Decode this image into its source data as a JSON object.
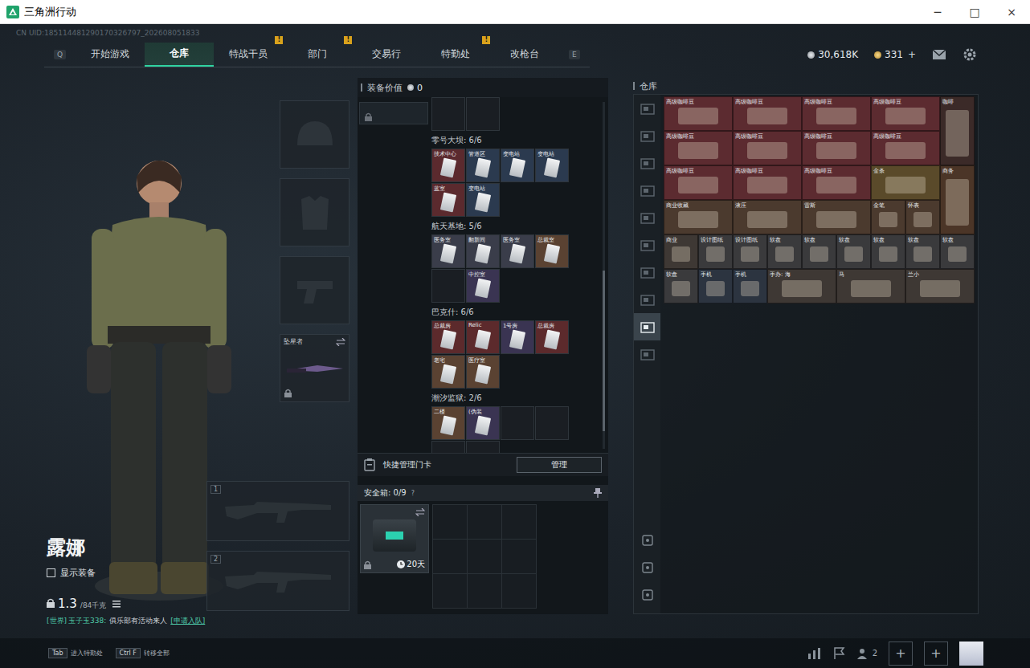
{
  "window": {
    "title": "三角洲行动",
    "controls": [
      "─",
      "□",
      "×"
    ]
  },
  "uid": "CN UID:185114481290170326797_202608051833",
  "nav": {
    "prev_key": "Q",
    "next_key": "E",
    "tabs": [
      {
        "label": "开始游戏",
        "selected": false,
        "badge": null
      },
      {
        "label": "仓库",
        "selected": true,
        "badge": null
      },
      {
        "label": "特战干员",
        "selected": false,
        "badge": "!"
      },
      {
        "label": "部门",
        "selected": false,
        "badge": "!"
      },
      {
        "label": "交易行",
        "selected": false,
        "badge": null
      },
      {
        "label": "特勤处",
        "selected": false,
        "badge": "!"
      },
      {
        "label": "改枪台",
        "selected": false,
        "badge": null
      }
    ]
  },
  "currency": [
    {
      "kind": "silver",
      "amount": "30,618K",
      "add": null
    },
    {
      "kind": "gold",
      "amount": "331",
      "add": "+"
    }
  ],
  "operator": {
    "name": "露娜",
    "show_gear": {
      "label": "显示装备",
      "checked": false
    },
    "weight": "1.3",
    "weight_max": "/84千克"
  },
  "chat": {
    "channel": "[世界]",
    "sender": "玉子玉338:",
    "message": "俱乐部有活动来人",
    "action": "[申请入队]"
  },
  "gear_slots": [
    {
      "kind": "helmet",
      "label": null,
      "locked": false
    },
    {
      "kind": "armor",
      "label": null,
      "locked": false
    },
    {
      "kind": "pistol",
      "label": null,
      "locked": false
    },
    {
      "kind": "melee",
      "label": "坠星者",
      "locked": true
    }
  ],
  "weapon_slots": [
    {
      "number": "1"
    },
    {
      "number": "2"
    }
  ],
  "loadout": {
    "value_label": "装备价值",
    "value": "0",
    "scrolled_slots": [
      {
        "kind": "empty"
      },
      {
        "kind": "empty"
      }
    ],
    "sections": [
      {
        "title": "零号大坝: 6/6",
        "cards": [
          {
            "kind": "card",
            "label": "技术中心",
            "color": "#5b2a2e"
          },
          {
            "kind": "card",
            "label": "管道区",
            "color": "#2b3a4f"
          },
          {
            "kind": "card",
            "label": "变电站",
            "color": "#2b3a4f"
          },
          {
            "kind": "card",
            "label": "变电站",
            "color": "#2b3a4f"
          },
          {
            "kind": "card",
            "label": "蓝室",
            "color": "#5b2a2e"
          },
          {
            "kind": "card",
            "label": "变电站",
            "color": "#2b3a4f"
          }
        ]
      },
      {
        "title": "航天基地: 5/6",
        "cards": [
          {
            "kind": "card",
            "label": "医务室",
            "color": "#3a3d4a"
          },
          {
            "kind": "card",
            "label": "翻新间",
            "color": "#3a3d4a"
          },
          {
            "kind": "card",
            "label": "医务室",
            "color": "#3a3d4a"
          },
          {
            "kind": "card",
            "label": "总裁室",
            "color": "#5a4232"
          },
          {
            "kind": "empty",
            "label": "",
            "color": "#1a1e23"
          },
          {
            "kind": "card",
            "label": "中控室",
            "color": "#3a3452"
          }
        ]
      },
      {
        "title": "巴克什: 6/6",
        "cards": [
          {
            "kind": "card",
            "label": "总裁房",
            "color": "#5c2a2c"
          },
          {
            "kind": "card",
            "label": "Relic",
            "color": "#5c2a2c"
          },
          {
            "kind": "card",
            "label": "1号房",
            "color": "#3a3452"
          },
          {
            "kind": "card",
            "label": "总裁房",
            "color": "#5c2a2c"
          },
          {
            "kind": "card",
            "label": "老宅",
            "color": "#5a4232"
          },
          {
            "kind": "card",
            "label": "医疗室",
            "color": "#5a4232"
          }
        ]
      },
      {
        "title": "潮汐监狱: 2/6",
        "cards": [
          {
            "kind": "card",
            "label": "二楼",
            "color": "#5a4232"
          },
          {
            "kind": "card",
            "label": "(伪装",
            "color": "#3a3452"
          },
          {
            "kind": "empty",
            "label": "",
            "color": "#1a1e23"
          },
          {
            "kind": "empty",
            "label": "",
            "color": "#1a1e23"
          },
          {
            "kind": "empty",
            "label": "",
            "color": "#1a1e23"
          },
          {
            "kind": "empty",
            "label": "",
            "color": "#1a1e23"
          }
        ]
      }
    ]
  },
  "quick_manage": {
    "label": "快捷管理门卡",
    "button": "管理"
  },
  "safe_box": {
    "label": "安全箱: 0/9",
    "help": "?",
    "timer": "20天",
    "locked": true,
    "cells": [
      {
        "kind": "empty"
      },
      {
        "kind": "empty"
      },
      {
        "kind": "empty"
      },
      {
        "kind": "empty"
      },
      {
        "kind": "empty"
      },
      {
        "kind": "empty"
      },
      {
        "kind": "empty"
      },
      {
        "kind": "empty"
      },
      {
        "kind": "empty"
      }
    ]
  },
  "warehouse": {
    "title": "仓库",
    "tabs": [
      {
        "selected": false
      },
      {
        "selected": false
      },
      {
        "selected": false
      },
      {
        "selected": false
      },
      {
        "selected": false
      },
      {
        "selected": false
      },
      {
        "selected": false
      },
      {
        "selected": false
      },
      {
        "selected": true
      },
      {
        "selected": false
      }
    ],
    "bottom_tabs": [
      {
        "selected": false
      },
      {
        "selected": false
      },
      {
        "selected": false
      }
    ],
    "items": [
      {
        "kind": "wide",
        "label": "高级咖啡豆",
        "color": "#5c2b30"
      },
      {
        "kind": "wide",
        "label": "高级咖啡豆",
        "color": "#5c2b30"
      },
      {
        "kind": "wide",
        "label": "高级咖啡豆",
        "color": "#5c2b30"
      },
      {
        "kind": "wide",
        "label": "高级咖啡豆",
        "color": "#5c2b30"
      },
      {
        "kind": "tall",
        "label": "咖啡",
        "color": "#3b2a28"
      },
      {
        "kind": "wide",
        "label": "高级咖啡豆",
        "color": "#5c2b30"
      },
      {
        "kind": "wide",
        "label": "高级咖啡豆",
        "color": "#5c2b30"
      },
      {
        "kind": "wide",
        "label": "高级咖啡豆",
        "color": "#5c2b30"
      },
      {
        "kind": "wide",
        "label": "高级咖啡豆",
        "color": "#5c2b30"
      },
      {
        "kind": "wide",
        "label": "高级咖啡豆",
        "color": "#5c2b30"
      },
      {
        "kind": "wide",
        "label": "高级咖啡豆",
        "color": "#5c2b30"
      },
      {
        "kind": "wide",
        "label": "高级咖啡豆",
        "color": "#5c2b30"
      },
      {
        "kind": "wide",
        "label": "金条",
        "color": "#5a4a2a"
      },
      {
        "kind": "tall",
        "label": "商务",
        "color": "#4b3527"
      },
      {
        "kind": "wide",
        "label": "商业收藏",
        "color": "#4b3a2e"
      },
      {
        "kind": "wide",
        "label": "液压",
        "color": "#4b3a2e"
      },
      {
        "kind": "wide",
        "label": "雷斯",
        "color": "#4b3a2e"
      },
      {
        "kind": "small",
        "label": "金笔",
        "color": "#4b3a2e"
      },
      {
        "kind": "small",
        "label": "怀表",
        "color": "#4b3a2e"
      },
      {
        "kind": "small",
        "label": "商业",
        "color": "#3e3834"
      },
      {
        "kind": "small",
        "label": "设计图纸",
        "color": "#3a3a3c"
      },
      {
        "kind": "small",
        "label": "设计图纸",
        "color": "#3a3a3c"
      },
      {
        "kind": "small",
        "label": "软盘",
        "color": "#3a3a3c"
      },
      {
        "kind": "small",
        "label": "软盘",
        "color": "#3a3a3c"
      },
      {
        "kind": "small",
        "label": "软盘",
        "color": "#3a3a3c"
      },
      {
        "kind": "small",
        "label": "软盘",
        "color": "#3a3a3c"
      },
      {
        "kind": "small",
        "label": "软盘",
        "color": "#3a3a3c"
      },
      {
        "kind": "small",
        "label": "软盘",
        "color": "#3a3a3c"
      },
      {
        "kind": "small",
        "label": "软盘",
        "color": "#3a3a3c"
      },
      {
        "kind": "small",
        "label": "手机",
        "color": "#2c3440"
      },
      {
        "kind": "small",
        "label": "手机",
        "color": "#2c3440"
      },
      {
        "kind": "wide",
        "label": "手办: 海",
        "color": "#3e3834"
      },
      {
        "kind": "wide",
        "label": "马",
        "color": "#3e3834"
      },
      {
        "kind": "wide",
        "label": "兰小",
        "color": "#3e3834"
      }
    ]
  },
  "bottom_bar": {
    "hints": [
      {
        "key": "Tab",
        "label": "进入特勤处"
      },
      {
        "key": "Ctrl F",
        "label": "转移全部"
      }
    ],
    "friends": "2",
    "add_buttons": [
      "+",
      "+"
    ]
  }
}
